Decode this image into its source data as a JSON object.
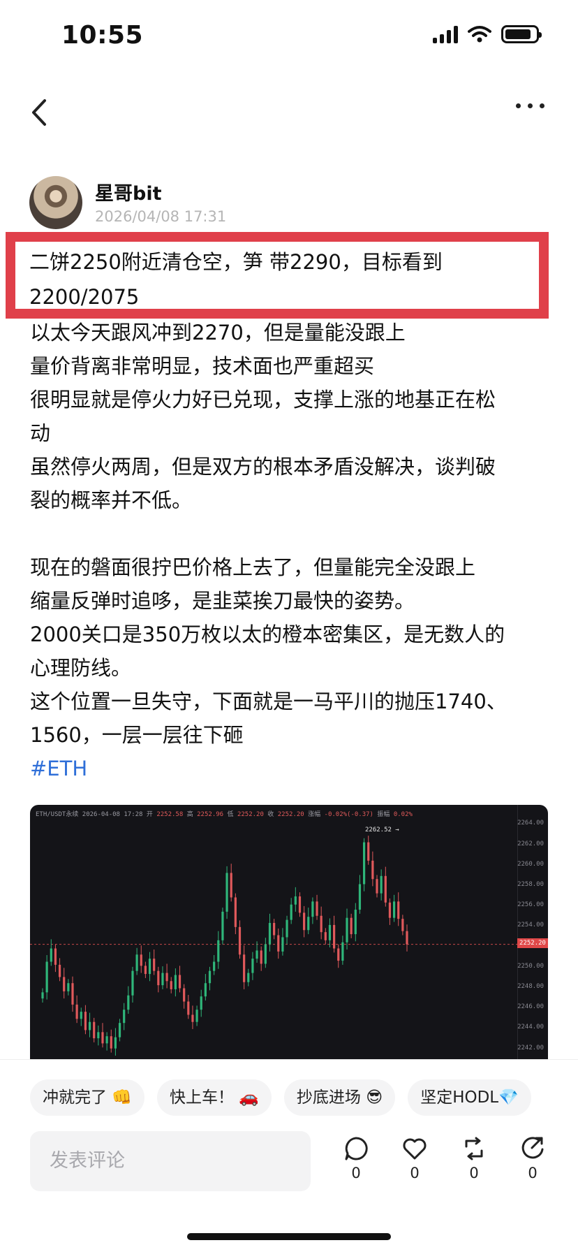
{
  "status_bar": {
    "time": "10:55",
    "battery_level": 0.85
  },
  "nav": {
    "back_icon": "chevron-left-icon",
    "more_icon": "more-dots-icon"
  },
  "author": {
    "name": "星哥bit",
    "timestamp": "2026/04/08 17:31"
  },
  "post": {
    "highlight_lines": [
      "二饼2250附近清仓空，笋 带2290，目标看到",
      "2200/2075"
    ],
    "paragraphs": [
      "以太今天跟风冲到2270，但是量能没跟上",
      "量价背离非常明显，技术面也严重超买",
      "很明显就是停火力好已兑现，支撑上涨的地基正在松\n动",
      "虽然停火两周，但是双方的根本矛盾没解决，谈判破\n裂的概率并不低。",
      "",
      "现在的磐面很拧巴价格上去了，但量能完全没跟上",
      "缩量反弹时追哆，是韭菜挨刀最快的姿势。",
      "2000关口是350万枚以太的橙本密集区，是无数人的\n心理防线。",
      "这个位置一旦失守，下面就是一马平川的抛压1740、\n1560，一层一层往下砸"
    ],
    "hashtag": "#ETH"
  },
  "chart_data": {
    "type": "candlestick",
    "header": {
      "symbol": "ETH/USDT永续",
      "time": "2026-04-08 17:28",
      "open_label": "开",
      "open": "2252.58",
      "high_label": "高",
      "high": "2252.96",
      "low_label": "低",
      "low": "2252.20",
      "close_label": "收",
      "close": "2252.20",
      "change_label": "涨幅",
      "change": "-0.02%(-0.37)",
      "amplitude_label": "振幅",
      "amplitude": "0.02%"
    },
    "y_ticks": [
      "2264.00",
      "2262.00",
      "2260.00",
      "2258.00",
      "2256.00",
      "2254.00",
      "2250.00",
      "2248.00",
      "2246.00",
      "2244.00",
      "2242.00"
    ],
    "last_price": "2252.20",
    "high_marker": "2262.52",
    "ylim": [
      2241.5,
      2264.5
    ],
    "closes": [
      2247.5,
      2250.5,
      2251.8,
      2250.2,
      2249.0,
      2247.6,
      2248.4,
      2246.3,
      2244.9,
      2245.6,
      2243.8,
      2244.6,
      2243.0,
      2243.6,
      2242.5,
      2243.2,
      2242.0,
      2243.1,
      2244.5,
      2245.8,
      2247.2,
      2249.6,
      2251.2,
      2250.1,
      2249.3,
      2250.8,
      2249.6,
      2248.2,
      2249.4,
      2248.6,
      2247.8,
      2249.2,
      2247.9,
      2246.6,
      2245.3,
      2244.6,
      2245.8,
      2247.1,
      2248.4,
      2249.6,
      2250.5,
      2252.6,
      2255.4,
      2259.2,
      2256.8,
      2253.9,
      2251.2,
      2248.5,
      2249.4,
      2250.8,
      2251.6,
      2250.3,
      2252.2,
      2254.3,
      2253.1,
      2251.5,
      2252.9,
      2254.6,
      2256.1,
      2256.9,
      2255.3,
      2253.6,
      2254.9,
      2256.4,
      2255.0,
      2253.4,
      2252.6,
      2254.1,
      2251.8,
      2250.6,
      2252.4,
      2254.8,
      2253.2,
      2255.6,
      2258.1,
      2262.2,
      2260.4,
      2258.6,
      2257.2,
      2258.9,
      2256.3,
      2254.8,
      2256.4,
      2254.7,
      2253.5,
      2252.2
    ]
  },
  "reactions": [
    "冲就完了 👊",
    "快上车！ 🚗",
    "抄底进场 😎",
    "坚定HODL💎"
  ],
  "comment_placeholder": "发表评论",
  "actions": [
    {
      "icon": "comment-icon",
      "count": "0"
    },
    {
      "icon": "heart-icon",
      "count": "0"
    },
    {
      "icon": "repost-icon",
      "count": "0"
    },
    {
      "icon": "share-icon",
      "count": "0"
    }
  ]
}
